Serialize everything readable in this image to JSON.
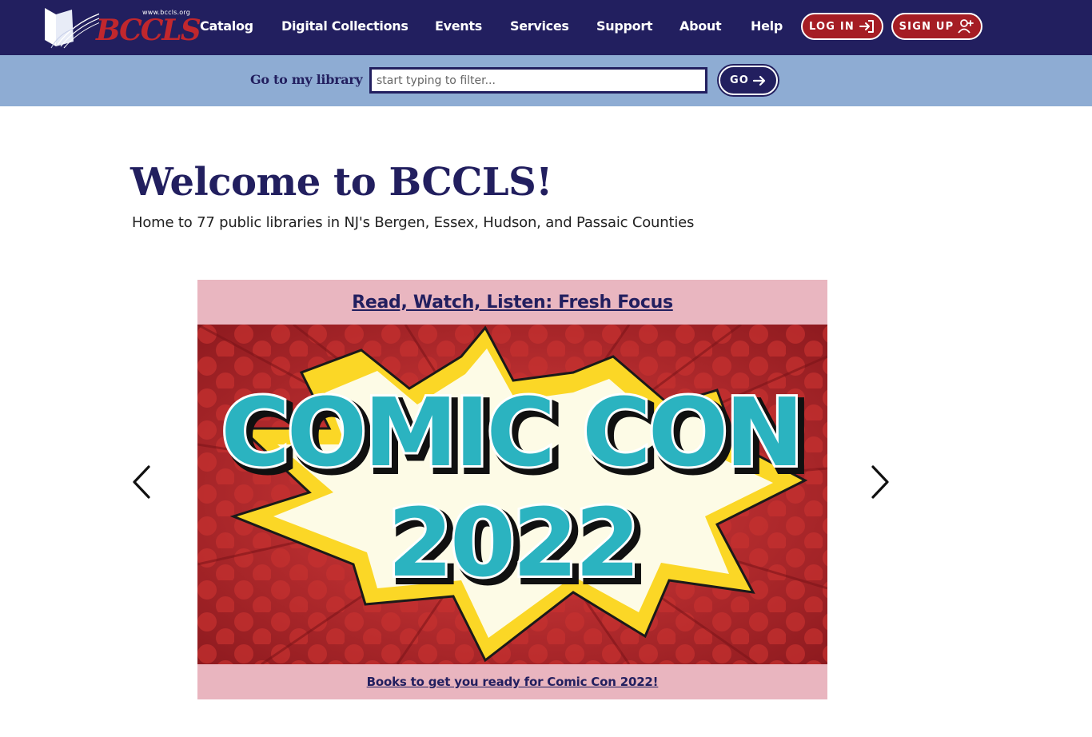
{
  "header": {
    "logo": {
      "url_text": "www.bccls.org",
      "wordmark": "BCCLS",
      "icon": "open-book-icon"
    },
    "nav": [
      {
        "label": "Catalog"
      },
      {
        "label": "Digital Collections"
      },
      {
        "label": "Events"
      },
      {
        "label": "Services"
      },
      {
        "label": "Support"
      },
      {
        "label": "About"
      },
      {
        "label": "Help"
      }
    ],
    "login": {
      "label": "LOG IN",
      "icon": "login-arrow-icon"
    },
    "signup": {
      "label": "SIGN UP",
      "icon": "user-plus-icon"
    },
    "colors": {
      "nav_bg": "#221f5f",
      "accent_red": "#a51d24"
    }
  },
  "library_bar": {
    "label": "Go to my library",
    "input_value": "",
    "input_placeholder": "start typing to filter...",
    "go_label": "GO",
    "go_icon": "arrow-right-icon",
    "bg": "#8eacd3"
  },
  "hero": {
    "title": "Welcome to BCCLS!",
    "tagline": "Home to 77 public libraries in NJ's Bergen, Essex, Hudson, and Passaic Counties"
  },
  "carousel": {
    "prev_icon": "chevron-left-icon",
    "next_icon": "chevron-right-icon",
    "slide": {
      "title": "Read, Watch, Listen: Fresh Focus",
      "image_text_line1": "COMIC CON",
      "image_text_line2": "2022",
      "caption": "Books to get you ready for Comic Con 2022!"
    }
  }
}
